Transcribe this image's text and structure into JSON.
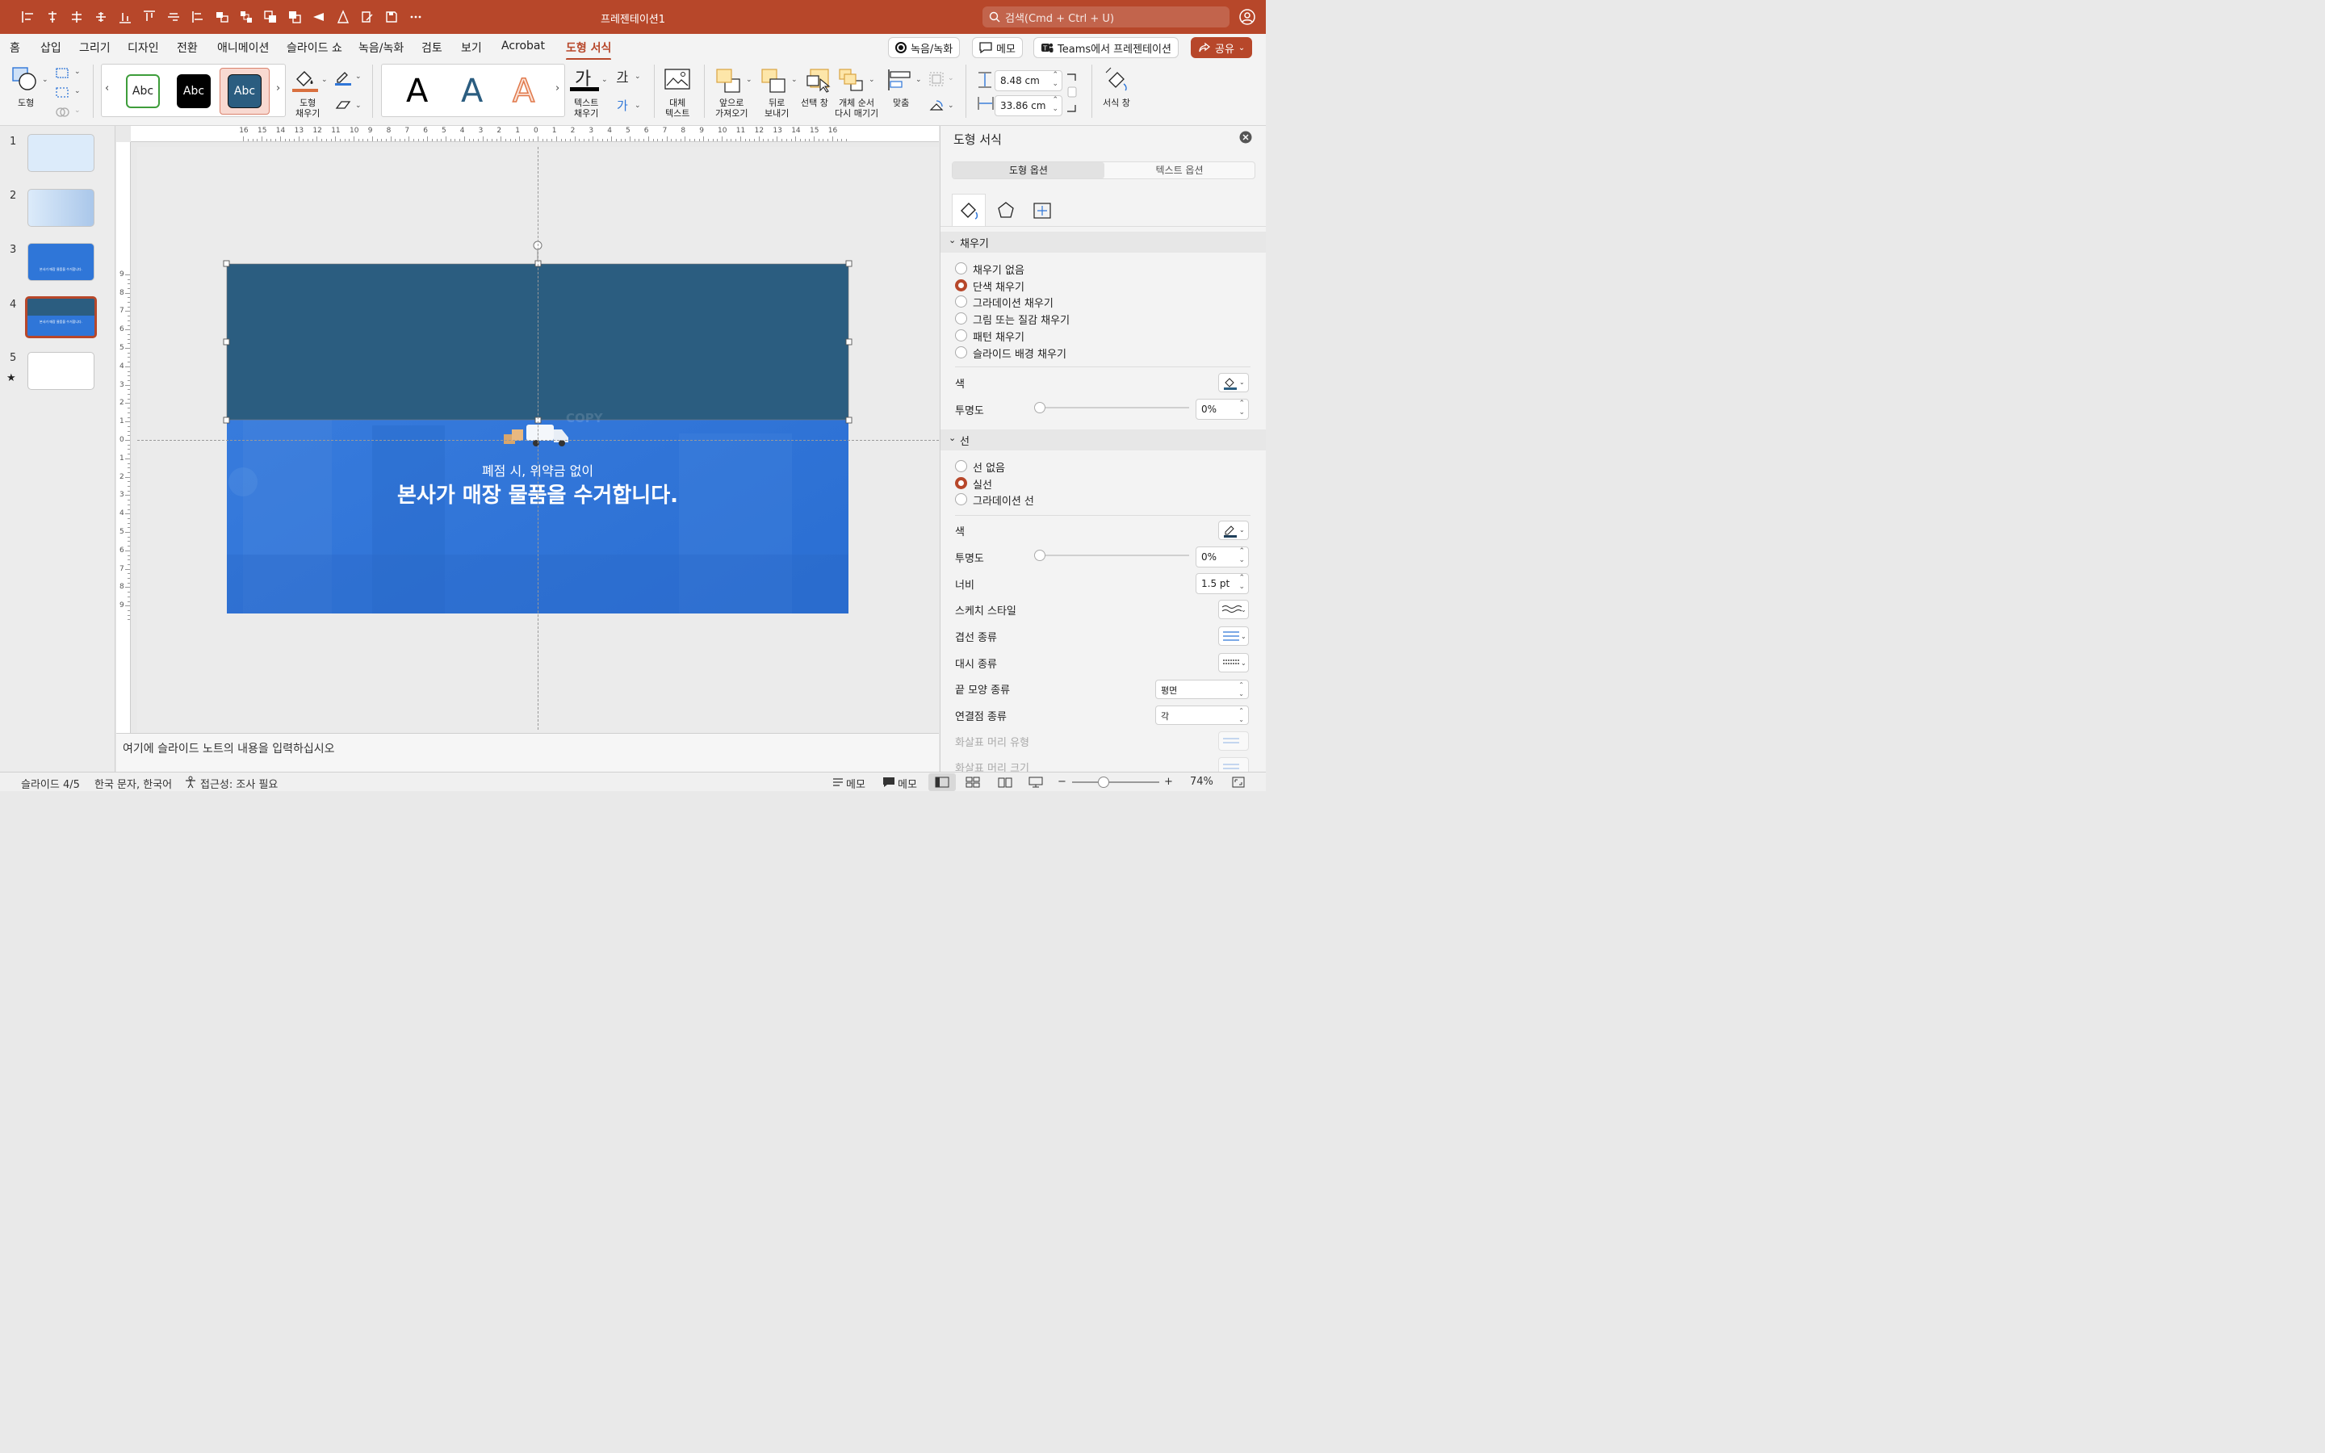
{
  "app": {
    "title": "프레젠테이션1"
  },
  "search": {
    "placeholder": "검색(Cmd + Ctrl + U)"
  },
  "colors": {
    "accent": "#b7472a",
    "shape_fill": "#2b5d80",
    "slide_bg": "#2f76d8"
  },
  "quick_access": [
    "align-left-icon",
    "align-center-icon",
    "align-right-icon",
    "distribute-icon",
    "align-bottom-icon",
    "align-top-icon",
    "align-middle-icon",
    "align-start-icon",
    "group-icon",
    "ungroup-icon",
    "bring-forward-icon",
    "send-backward-icon",
    "flip-icon",
    "rotate-icon",
    "edit-icon",
    "save-icon",
    "more-icon"
  ],
  "ribbon_tabs": [
    "홈",
    "삽입",
    "그리기",
    "디자인",
    "전환",
    "애니메이션",
    "슬라이드 쇼",
    "녹음/녹화",
    "검토",
    "보기",
    "Acrobat",
    "도형 서식"
  ],
  "active_tab": "도형 서식",
  "tabbar_buttons": {
    "record": "녹음/녹화",
    "memo": "메모",
    "teams": "Teams에서 프레젠테이션",
    "share": "공유"
  },
  "ribbon": {
    "shape": "도형",
    "style_gallery": [
      "Abc",
      "Abc",
      "Abc"
    ],
    "shape_fill": "도형\n채우기",
    "wordart": [
      "A",
      "A",
      "A"
    ],
    "text_fill_glyph": "가",
    "text_fill": "텍스트\n채우기",
    "text_outline_glyph": "가",
    "text_effect_glyph": "가",
    "alt_text": "대체\n텍스트",
    "bring_forward": "앞으로\n가져오기",
    "send_backward": "뒤로\n보내기",
    "selection_pane": "선택 창",
    "reorder": "개체 순서\n다시 매기기",
    "align": "맞춤",
    "height": "8.48 cm",
    "width": "33.86 cm",
    "format_pane": "서식 창"
  },
  "thumbnails": [
    {
      "num": "1"
    },
    {
      "num": "2"
    },
    {
      "num": "3",
      "text": "본사가 매장 물품을 수거합니다."
    },
    {
      "num": "4",
      "text": "본사가 매장 물품을 수거합니다."
    },
    {
      "num": "5",
      "star": "★"
    }
  ],
  "ruler": {
    "h": [
      "16",
      "15",
      "14",
      "13",
      "12",
      "11",
      "10",
      "9",
      "8",
      "7",
      "6",
      "5",
      "4",
      "3",
      "2",
      "1",
      "0",
      "1",
      "2",
      "3",
      "4",
      "5",
      "6",
      "7",
      "8",
      "9",
      "10",
      "11",
      "12",
      "13",
      "14",
      "15",
      "16"
    ],
    "v": [
      "9",
      "8",
      "7",
      "6",
      "5",
      "4",
      "3",
      "2",
      "1",
      "0",
      "1",
      "2",
      "3",
      "4",
      "5",
      "6",
      "7",
      "8",
      "9"
    ]
  },
  "slide": {
    "subtitle": "폐점 시, 위약금 없이",
    "title": "본사가 매장 물품을 수거합니다.",
    "watermark": "COPY"
  },
  "notes": {
    "placeholder": "여기에 슬라이드 노트의 내용을 입력하십시오"
  },
  "pane": {
    "title": "도형 서식",
    "tabs": [
      "도형 옵션",
      "텍스트 옵션"
    ],
    "fill_section": "채우기",
    "fill_options": [
      "채우기 없음",
      "단색 채우기",
      "그라데이션 채우기",
      "그림 또는 질감 채우기",
      "패턴 채우기",
      "슬라이드 배경 채우기"
    ],
    "fill_selected": 1,
    "fill_color_label": "색",
    "fill_transparency_label": "투명도",
    "fill_transparency": "0%",
    "fill_transparency_value": 0,
    "line_section": "선",
    "line_options": [
      "선 없음",
      "실선",
      "그라데이션 선"
    ],
    "line_selected": 1,
    "line_color_label": "색",
    "line_transparency_label": "투명도",
    "line_transparency": "0%",
    "line_transparency_value": 0,
    "width_label": "너비",
    "width": "1.5 pt",
    "sketch_label": "스케치 스타일",
    "compound_label": "겹선 종류",
    "dash_label": "대시 종류",
    "cap_label": "끝 모양 종류",
    "cap_value": "평면",
    "join_label": "연결점 종류",
    "join_value": "각",
    "arrow_head_type_label": "화살표 머리 유형",
    "arrow_head_size_label": "화살표 머리 크기"
  },
  "status": {
    "slide": "슬라이드 4/5",
    "language": "한국 문자, 한국어",
    "accessibility": "접근성: 조사 필요",
    "notes": "메모",
    "comments": "메모",
    "zoom": "74%"
  }
}
